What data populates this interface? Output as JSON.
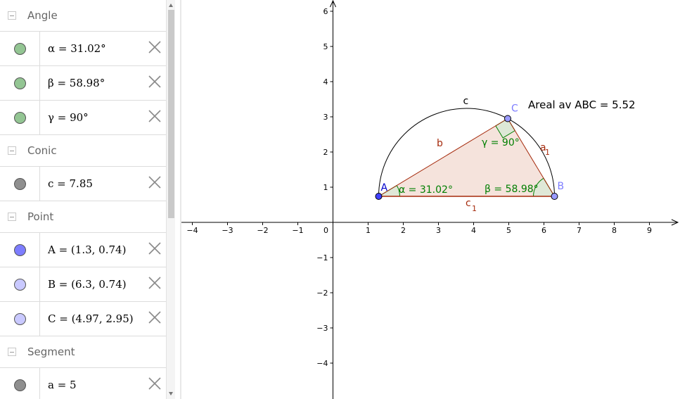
{
  "algebra": {
    "groups": [
      {
        "label": "Angle",
        "items": [
          {
            "text": "α = 31.02°",
            "color": "#93c593"
          },
          {
            "text": "β = 58.98°",
            "color": "#93c593"
          },
          {
            "text": "γ = 90°",
            "color": "#93c593"
          }
        ]
      },
      {
        "label": "Conic",
        "items": [
          {
            "text": "c = 7.85",
            "color": "#8f8f8f"
          }
        ]
      },
      {
        "label": "Point",
        "items": [
          {
            "text": "A = (1.3, 0.74)",
            "color": "#7d7dff"
          },
          {
            "text": "B = (6.3, 0.74)",
            "color": "#c9c9ff"
          },
          {
            "text": "C = (4.97, 2.95)",
            "color": "#c9c9ff"
          }
        ]
      },
      {
        "label": "Segment",
        "items": [
          {
            "text": "a = 5",
            "color": "#8f8f8f"
          }
        ]
      }
    ]
  },
  "graphics": {
    "x_ticks": [
      "−4",
      "−3",
      "−2",
      "−1",
      "0",
      "1",
      "2",
      "3",
      "4",
      "5",
      "6",
      "7",
      "8",
      "9"
    ],
    "y_ticks_pos": [
      "1",
      "2",
      "3",
      "4",
      "5",
      "6"
    ],
    "y_ticks_neg": [
      "−1",
      "−2",
      "−3",
      "−4"
    ],
    "point_A": {
      "label": "A",
      "x": 1.3,
      "y": 0.74
    },
    "point_B": {
      "label": "B",
      "x": 6.3,
      "y": 0.74
    },
    "point_C": {
      "label": "C",
      "x": 4.97,
      "y": 2.95
    },
    "label_arc": "c",
    "label_b": "b",
    "label_a": "a",
    "label_a_sub": "1",
    "label_c1": "c",
    "label_c1_sub": "1",
    "angle_alpha": "α = 31.02°",
    "angle_beta": "β = 58.98°",
    "angle_gamma": "γ = 90°",
    "area_text": "Areal av  ABC = 5.52",
    "colors": {
      "polygon": "#a52a0c",
      "polygon_fill": "#f5e3dc",
      "angle": "#007f00",
      "angle_fill": "#dde8d6",
      "point_A": "#4040ff",
      "point_light": "#9b9bff"
    }
  }
}
